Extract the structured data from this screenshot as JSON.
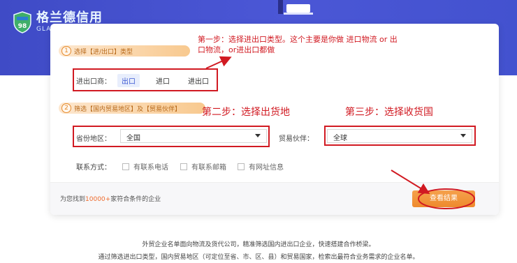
{
  "brand": {
    "name_cn": "格兰德信用",
    "name_en": "GLADTRUST",
    "badge_text": "98"
  },
  "step1": {
    "num": "1",
    "label": "选择【进/出口】类型"
  },
  "type_row": {
    "label": "进出口商：",
    "options": [
      "出口",
      "进口",
      "进出口"
    ],
    "selected": "出口"
  },
  "step2": {
    "num": "2",
    "label": "筛选【国内贸易地区】及【贸易伙伴】"
  },
  "region": {
    "label": "省份地区：",
    "value": "全国"
  },
  "partner": {
    "label": "贸易伙伴：",
    "value": "全球"
  },
  "contact": {
    "label": "联系方式：",
    "options": [
      "有联系电话",
      "有联系邮箱",
      "有网址信息"
    ]
  },
  "result": {
    "prefix": "为您找到",
    "count": "10000+",
    "suffix": "家符合条件的企业"
  },
  "view_button": "查看结果",
  "annotations": {
    "step1_line1": "第一步：选择进出口类型。这个主要是你做  进口物流 or  出",
    "step1_line2": "口物流，or进出口都做",
    "step2": "第二步：选择出货地",
    "step3": "第三步：选择收货国"
  },
  "footer": {
    "line1": "外贸企业名单面向物流及货代公司，精准筛选国内进出口企业，快速搭建合作桥梁。",
    "line2": "通过筛选进出口类型，国内贸易地区（可定位至省、市、区、县）和贸易国家，检索出最符合业务需求的企业名单。"
  },
  "colors": {
    "hero": "#4352cf",
    "accent_orange": "#ee8a2d",
    "annotation_red": "#d11a22",
    "selected_blue": "#3d59d3"
  }
}
